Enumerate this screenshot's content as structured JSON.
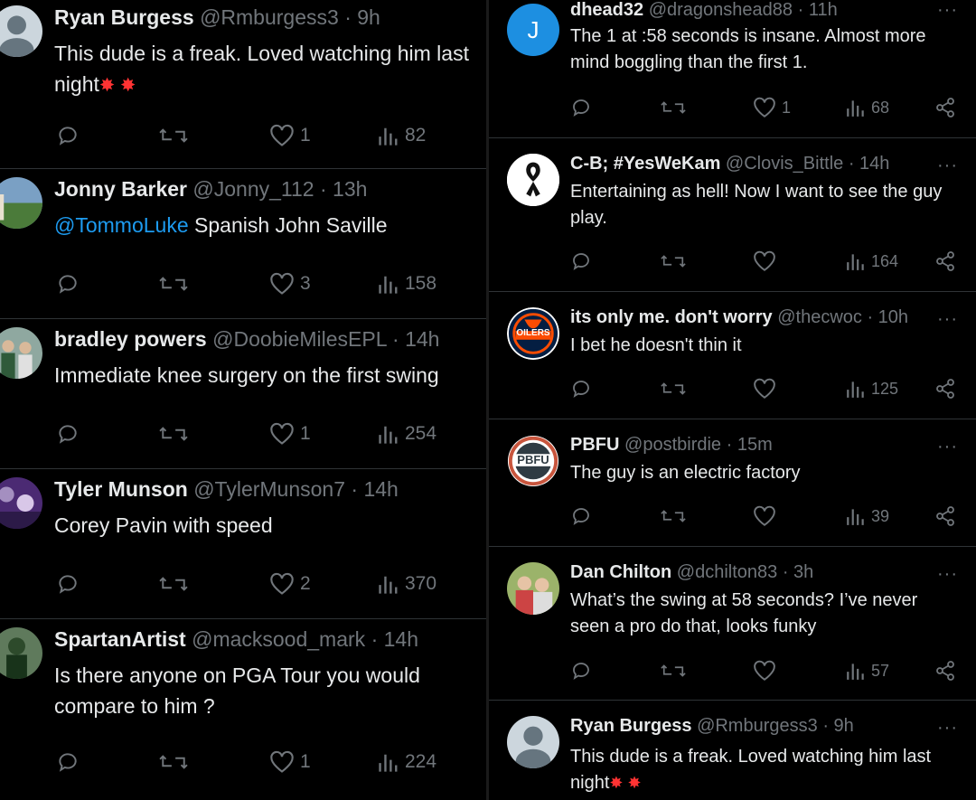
{
  "left_column": [
    {
      "name": "Ryan Burgess",
      "handle": "@Rmburgess3",
      "time": "· 9h",
      "text": "This dude is a freak. Loved watching him last night",
      "bursts": "✸ ✸",
      "replies": "",
      "reposts": "",
      "likes": "1",
      "views": "82"
    },
    {
      "name": "Jonny Barker",
      "handle": "@Jonny_112",
      "time": "· 13h",
      "mention": "@TommoLuke",
      "text": " Spanish John Saville",
      "replies": "",
      "reposts": "",
      "likes": "3",
      "views": "158"
    },
    {
      "name": "bradley powers",
      "handle": "@DoobieMilesEPL",
      "time": "· 14h",
      "text": "Immediate knee surgery on the first swing",
      "replies": "",
      "reposts": "",
      "likes": "1",
      "views": "254"
    },
    {
      "name": "Tyler Munson",
      "handle": "@TylerMunson7",
      "time": "· 14h",
      "text": "Corey Pavin with speed",
      "replies": "",
      "reposts": "",
      "likes": "2",
      "views": "370"
    },
    {
      "name": "SpartanArtist",
      "handle": "@macksood_mark",
      "time": "· 14h",
      "text": "Is there anyone on PGA Tour you would compare to him  ?",
      "replies": "",
      "reposts": "",
      "likes": "1",
      "views": "224"
    }
  ],
  "right_column": [
    {
      "name": "dhead32",
      "handle": "@dragonshead88",
      "time": "· 11h",
      "avatar_letter": "J",
      "text": "The 1 at :58 seconds is insane. Almost more mind boggling than the first 1.",
      "replies": "",
      "reposts": "",
      "likes": "1",
      "views": "68"
    },
    {
      "name": "C-B; #YesWeKam",
      "handle": "@Clovis_Bittle",
      "time": "· 14h",
      "text": "Entertaining as hell! Now I want to see the guy play.",
      "replies": "",
      "reposts": "",
      "likes": "",
      "views": "164"
    },
    {
      "name": "its only me. don't worry",
      "handle": "@thecwoc",
      "time": "· 10h",
      "avatar_text": "OILERS",
      "text": "I bet he doesn't thin it",
      "replies": "",
      "reposts": "",
      "likes": "",
      "views": "125"
    },
    {
      "name": "PBFU",
      "handle": "@postbirdie",
      "time": "· 15m",
      "avatar_text": "PBFU",
      "text": "The guy is an electric factory",
      "replies": "",
      "reposts": "",
      "likes": "",
      "views": "39"
    },
    {
      "name": "Dan Chilton",
      "handle": "@dchilton83",
      "time": "· 3h",
      "text": "What’s the swing at 58 seconds? I’ve never seen a pro do that, looks funky",
      "replies": "",
      "reposts": "",
      "likes": "",
      "views": "57"
    },
    {
      "name": "Ryan Burgess",
      "handle": "@Rmburgess3",
      "time": "· 9h",
      "text": "This dude is a freak. Loved watching him last night",
      "bursts": "✸ ✸"
    }
  ],
  "more_label": "···",
  "colors": {
    "background": "#000000",
    "text": "#e7e9ea",
    "muted": "#71767b",
    "link": "#1d9bf0",
    "divider": "#2f3336"
  }
}
